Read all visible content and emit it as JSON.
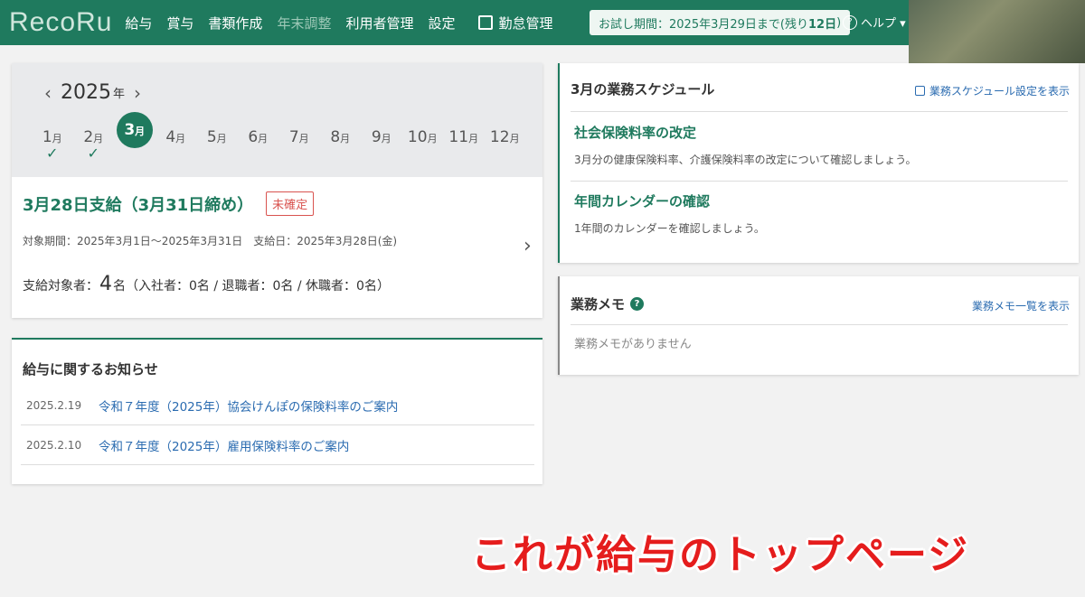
{
  "header": {
    "logo": "RecoRu",
    "nav": [
      "給与",
      "賞与",
      "書類作成",
      "年末調整",
      "利用者管理",
      "設定"
    ],
    "nav_disabled": "年末調整",
    "attendance_link": "勤怠管理",
    "trial_prefix": "お試し期間：2025年3月29日まで(残り",
    "trial_days": "12日",
    "trial_suffix": ")",
    "help": "ヘルプ ▾"
  },
  "calendar": {
    "year": "2025",
    "year_unit": "年",
    "prev_arrow": "‹",
    "next_arrow": "›",
    "months": [
      {
        "num": "1",
        "unit": "月",
        "check": "✓"
      },
      {
        "num": "2",
        "unit": "月",
        "check": "✓"
      },
      {
        "num": "3",
        "unit": "月",
        "check": ""
      },
      {
        "num": "4",
        "unit": "月",
        "check": ""
      },
      {
        "num": "5",
        "unit": "月",
        "check": ""
      },
      {
        "num": "6",
        "unit": "月",
        "check": ""
      },
      {
        "num": "7",
        "unit": "月",
        "check": ""
      },
      {
        "num": "8",
        "unit": "月",
        "check": ""
      },
      {
        "num": "9",
        "unit": "月",
        "check": ""
      },
      {
        "num": "10",
        "unit": "月",
        "check": ""
      },
      {
        "num": "11",
        "unit": "月",
        "check": ""
      },
      {
        "num": "12",
        "unit": "月",
        "check": ""
      }
    ]
  },
  "payroll": {
    "title": "3月28日支給（3月31日締め）",
    "status": "未確定",
    "period": "対象期間：2025年3月1日〜2025年3月31日",
    "payday": "支給日：2025年3月28日(金)",
    "count_label": "支給対象者：",
    "count_value": "4",
    "count_unit": "名",
    "breakdown": "（入社者：0名 / 退職者：0名 / 休職者：0名）",
    "chevron": "›"
  },
  "news": {
    "title": "給与に関するお知らせ",
    "items": [
      {
        "date": "2025.2.19",
        "text": "令和７年度（2025年）協会けんぽの保険料率のご案内"
      },
      {
        "date": "2025.2.10",
        "text": "令和７年度（2025年）雇用保険料率のご案内"
      }
    ]
  },
  "schedule": {
    "title": "3月の業務スケジュール",
    "link": "業務スケジュール設定を表示",
    "items": [
      {
        "title": "社会保険料率の改定",
        "desc": "3月分の健康保険料率、介護保険料率の改定について確認しましょう。"
      },
      {
        "title": "年間カレンダーの確認",
        "desc": "1年間のカレンダーを確認しましょう。"
      }
    ]
  },
  "memo": {
    "title": "業務メモ",
    "help_icon": "?",
    "link": "業務メモ一覧を表示",
    "empty": "業務メモがありません"
  },
  "caption": "これが給与のトップページ",
  "colors": {
    "brand": "#1f7a5e",
    "link": "#2a6bb0",
    "alert": "#d9534f",
    "caption": "#e51d1d"
  }
}
